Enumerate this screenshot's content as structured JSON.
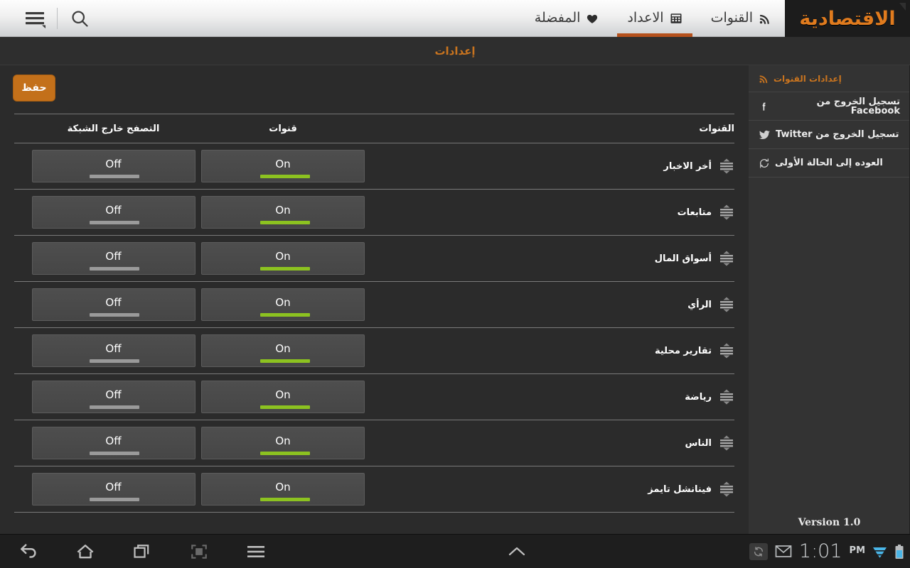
{
  "header": {
    "logo_text": "الاقتصادية",
    "tabs": [
      {
        "label": "القنوات",
        "icon": "rss-icon",
        "active": false
      },
      {
        "label": "الاعداد",
        "icon": "chart-icon",
        "active": true
      },
      {
        "label": "المفضلة",
        "icon": "heart-icon",
        "active": false
      }
    ],
    "search_icon": "search-icon",
    "menu_icon": "hamburger-menu-icon"
  },
  "page_title": "إعدادات",
  "toolbar": {
    "save_label": "حفظ"
  },
  "table": {
    "columns": {
      "name": "القنوات",
      "on": "قنوات",
      "off": "التصفح خارج الشبكة"
    },
    "rows": [
      {
        "name": "أخر الاخبار",
        "channels": "On",
        "offline": "Off"
      },
      {
        "name": "متابعات",
        "channels": "On",
        "offline": "Off"
      },
      {
        "name": "أسواق المال",
        "channels": "On",
        "offline": "Off"
      },
      {
        "name": "الرأي",
        "channels": "On",
        "offline": "Off"
      },
      {
        "name": "تقارير محلية",
        "channels": "On",
        "offline": "Off"
      },
      {
        "name": "رياضة",
        "channels": "On",
        "offline": "Off"
      },
      {
        "name": "الناس",
        "channels": "On",
        "offline": "Off"
      },
      {
        "name": "فينانشل تايمز",
        "channels": "On",
        "offline": "Off"
      }
    ]
  },
  "sidebar": {
    "items": [
      {
        "label": "إعدادات القنوات",
        "icon": "rss-icon"
      },
      {
        "label": "تسجيل الخروج من Facebook",
        "icon": "facebook-icon"
      },
      {
        "label": "تسجيل الخروج من Twitter",
        "icon": "twitter-icon"
      },
      {
        "label": "العوده إلى الحالة الأولى",
        "icon": "refresh-icon"
      }
    ],
    "version": "Version 1.0"
  },
  "system_bar": {
    "buttons": [
      "back-icon",
      "home-icon",
      "recents-icon",
      "screenshot-icon",
      "menu-icon",
      "chevron-up-icon"
    ],
    "time": "1:01",
    "ampm": "PM",
    "icons": [
      "sync-icon",
      "email-icon",
      "wifi-icon",
      "battery-icon"
    ]
  },
  "colors": {
    "accent_orange": "#c9741f",
    "logo_orange": "#e07b1e",
    "toggle_on_green": "#8cc220",
    "toggle_off_gray": "#9a9a9a",
    "page_bg": "#2b2b2b",
    "sidebar_bg": "#333333"
  }
}
